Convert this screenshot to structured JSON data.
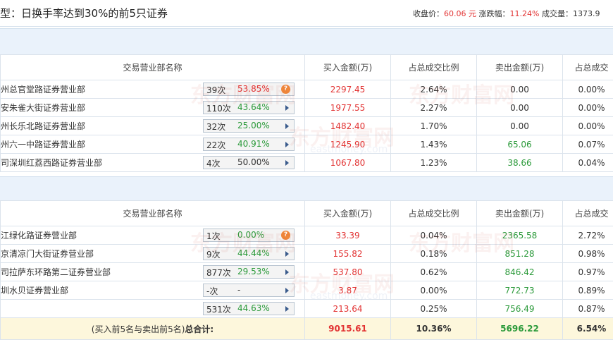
{
  "header": {
    "title": "型：日换手率达到30%的前5只证券",
    "close_label": "收盘价：",
    "close_value": "60.06 元",
    "change_label": "涨跌幅：",
    "change_value": "11.24%",
    "volume_label": "成交量：",
    "volume_value": "1373.9"
  },
  "columns": {
    "dept": "交易营业部名称",
    "buy": "买入金额(万)",
    "ratio1": "占总成交比例",
    "sell": "卖出金额(万)",
    "ratio2": "占总成交"
  },
  "buy_rows": [
    {
      "name": "州总官堂路证券营业部",
      "count": "39次",
      "pct": "53.85%",
      "pct_color": "red",
      "marker": "question-icon",
      "buy": "2297.45",
      "r1": "2.64%",
      "sell": "0.00",
      "r2": "0.00%",
      "sell_color": "neutral"
    },
    {
      "name": "安朱雀大街证券营业部",
      "count": "110次",
      "pct": "43.64%",
      "pct_color": "green",
      "marker": "arrow-right-icon",
      "buy": "1977.55",
      "r1": "2.27%",
      "sell": "0.00",
      "r2": "0.00%",
      "sell_color": "neutral"
    },
    {
      "name": "州长乐北路证券营业部",
      "count": "32次",
      "pct": "25.00%",
      "pct_color": "green",
      "marker": "arrow-right-icon",
      "buy": "1482.40",
      "r1": "1.70%",
      "sell": "0.00",
      "r2": "0.00%",
      "sell_color": "neutral"
    },
    {
      "name": "州六一中路证券营业部",
      "count": "22次",
      "pct": "40.91%",
      "pct_color": "green",
      "marker": "arrow-right-icon",
      "buy": "1245.90",
      "r1": "1.43%",
      "sell": "65.06",
      "r2": "0.07%",
      "sell_color": "sell"
    },
    {
      "name": "司深圳红荔西路证券营业部",
      "count": "4次",
      "pct": "50.00%",
      "pct_color": "neutral",
      "marker": "arrow-right-icon",
      "buy": "1067.80",
      "r1": "1.23%",
      "sell": "38.66",
      "r2": "0.04%",
      "sell_color": "sell"
    }
  ],
  "sell_rows": [
    {
      "name": "江绿化路证券营业部",
      "count": "1次",
      "pct": "0.00%",
      "pct_color": "green",
      "marker": "question-icon",
      "buy": "33.39",
      "r1": "0.04%",
      "sell": "2365.58",
      "r2": "2.72%"
    },
    {
      "name": "京清凉门大街证券营业部",
      "count": "9次",
      "pct": "44.44%",
      "pct_color": "green",
      "marker": "arrow-right-icon",
      "buy": "155.82",
      "r1": "0.18%",
      "sell": "851.28",
      "r2": "0.98%"
    },
    {
      "name": "司拉萨东环路第二证券营业部",
      "count": "877次",
      "pct": "29.53%",
      "pct_color": "green",
      "marker": "arrow-right-icon",
      "buy": "537.80",
      "r1": "0.62%",
      "sell": "846.42",
      "r2": "0.97%"
    },
    {
      "name": "圳水贝证券营业部",
      "count": "-次",
      "pct": "-",
      "pct_color": "neutral",
      "marker": "arrow-right-icon",
      "buy": "3.87",
      "r1": "0.00%",
      "sell": "772.73",
      "r2": "0.89%"
    },
    {
      "name": "",
      "count": "531次",
      "pct": "44.63%",
      "pct_color": "green",
      "marker": "arrow-right-icon",
      "buy": "213.64",
      "r1": "0.25%",
      "sell": "756.49",
      "r2": "0.87%"
    }
  ],
  "total": {
    "label_prefix": "(买入前5名与卖出前5名)",
    "label_bold": "总合计:",
    "buy": "9015.61",
    "r1": "10.36%",
    "sell": "5696.22",
    "r2": "6.54%"
  },
  "watermark": {
    "cn": "东方财富网",
    "en": "eastmoney.com"
  },
  "colors": {
    "red": "#e23333",
    "green": "#2b9a3a",
    "band": "#eaf2fb",
    "total_bg": "#fdf7dc",
    "icon_orange": "#f0883a"
  }
}
